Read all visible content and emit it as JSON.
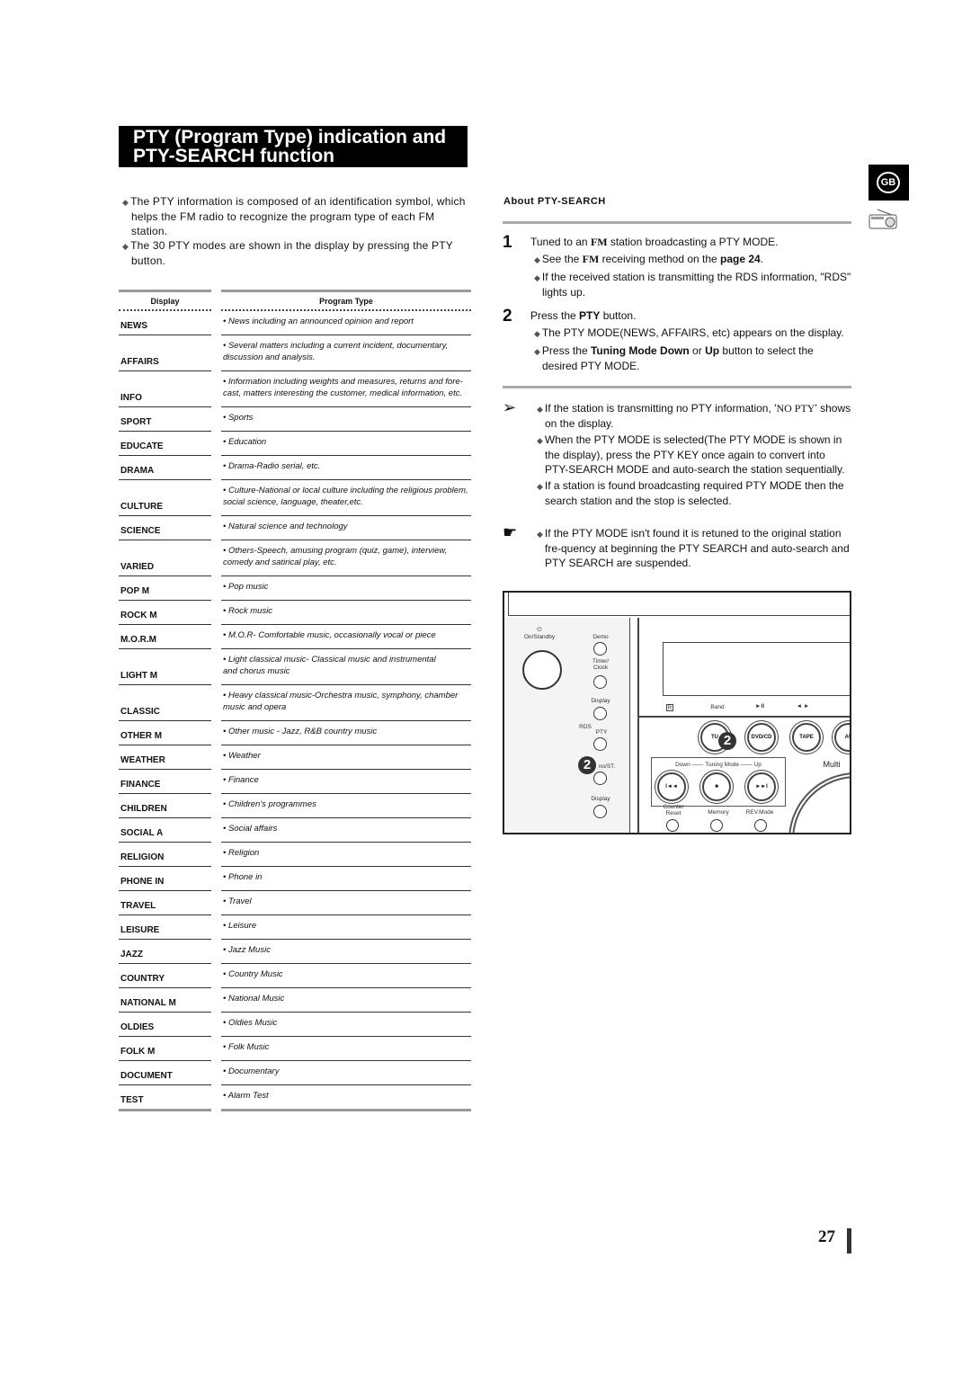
{
  "title": {
    "line1": "PTY (Program Type) indication and",
    "line2": "PTY-SEARCH function"
  },
  "intro": [
    "The PTY information is composed of an identification symbol, which helps the FM radio to recognize the program type of each FM station.",
    "The 30 PTY modes are shown in the display by pressing the PTY button."
  ],
  "table": {
    "headers": {
      "display": "Display",
      "program_type": "Program Type"
    },
    "rows": [
      {
        "display": "NEWS",
        "type": "• News including an announced opinion and report"
      },
      {
        "display": "AFFAIRS",
        "type": "• Several matters including a current incident, documentary,\n  discussion and analysis."
      },
      {
        "display": "INFO",
        "type": "•  Information including weights and measures, returns and fore-\n   cast, matters interesting the customer, medical information, etc."
      },
      {
        "display": "SPORT",
        "type": "• Sports"
      },
      {
        "display": "EDUCATE",
        "type": "• Education"
      },
      {
        "display": "DRAMA",
        "type": "• Drama-Radio serial, etc."
      },
      {
        "display": "CULTURE",
        "type": "• Culture-National or local culture including the religious problem,\n  social science, language, theater,etc."
      },
      {
        "display": "SCIENCE",
        "type": "• Natural science and technology"
      },
      {
        "display": "VARIED",
        "type": "• Others-Speech, amusing program (quiz, game), interview,\n  comedy and satirical play, etc."
      },
      {
        "display": "POP M",
        "type": "• Pop music"
      },
      {
        "display": "ROCK M",
        "type": "• Rock music"
      },
      {
        "display": "M.O.R.M",
        "type": "• M.O.R- Comfortable music, occasionally vocal or piece"
      },
      {
        "display": "LIGHT M",
        "type": "• Light classical music- Classical music and instrumental\n  and chorus music"
      },
      {
        "display": "CLASSIC",
        "type": "• Heavy classical  music-Orchestra music, symphony, chamber\n  music and opera"
      },
      {
        "display": "OTHER M",
        "type": "• Other music - Jazz, R&B country music"
      },
      {
        "display": "WEATHER",
        "type": "• Weather"
      },
      {
        "display": "FINANCE",
        "type": "• Finance"
      },
      {
        "display": "CHILDREN",
        "type": "• Children's programmes"
      },
      {
        "display": "SOCIAL  A",
        "type": "• Social affairs"
      },
      {
        "display": "RELIGION",
        "type": "• Religion"
      },
      {
        "display": "PHONE IN",
        "type": "• Phone in"
      },
      {
        "display": "TRAVEL",
        "type": "• Travel"
      },
      {
        "display": "LEISURE",
        "type": "• Leisure"
      },
      {
        "display": "JAZZ",
        "type": "• Jazz Music"
      },
      {
        "display": "COUNTRY",
        "type": "• Country Music"
      },
      {
        "display": "NATIONAL M",
        "type": "• National Music"
      },
      {
        "display": "OLDIES",
        "type": "• Oldies Music"
      },
      {
        "display": "FOLK M",
        "type": "• Folk Music"
      },
      {
        "display": "DOCUMENT",
        "type": "• Documentary"
      },
      {
        "display": "TEST",
        "type": "• Alarm Test"
      }
    ]
  },
  "about": {
    "heading": "About  PTY-SEARCH",
    "step1": {
      "num": "1",
      "pre": "Tuned to an ",
      "fm": "FM",
      "post": " station broadcasting a PTY MODE.",
      "sub1": {
        "pre": "See the ",
        "fm": "FM",
        "mid": " receiving method on the ",
        "bold": "page 24",
        "post": "."
      },
      "sub2": "If the received station is transmitting the RDS information, \"RDS\" lights up."
    },
    "step2": {
      "num": "2",
      "pre": "Press the ",
      "bold": "PTY",
      "post": " button.",
      "sub1": "The PTY MODE(NEWS, AFFAIRS, etc) appears on the display.",
      "sub2": {
        "pre": "Press the ",
        "b1": "Tuning Mode Down",
        "mid": " or ",
        "b2": "Up",
        "post": " button to select the desired PTY MODE."
      }
    },
    "notes": {
      "n1": {
        "pre": "If the station is transmitting no PTY information, '",
        "serif": "NO PTY",
        "post": "' shows on the display."
      },
      "n2": "When the PTY MODE is selected(The PTY MODE is shown in  the display), press the PTY KEY once again to convert into PTY-SEARCH MODE and auto-search the station sequentially.",
      "n3": "If a station is found broadcasting required PTY MODE then the search station and the stop is selected.",
      "n4": "If the PTY MODE isn't found it is retuned to the original station fre-quency at beginning the PTY SEARCH and auto-search and PTY SEARCH are suspended."
    }
  },
  "badge": "GB",
  "device": {
    "labels": {
      "on_standby": "On/Standby",
      "demo": "Demo",
      "timer_clock": "Timer/\nClock",
      "display1": "Display",
      "rds": "RDS",
      "pty": "PTY",
      "mono_st": "no/ST.",
      "display2": "Display",
      "band": "Band",
      "play_pause": "►II",
      "skip": "◄ ►",
      "r": "R",
      "tuner": "TU",
      "dvdcd": "DVD/CD",
      "tape": "TAPE",
      "aux": "AU",
      "down": "Down",
      "tuning_mode": "Tuning Mode",
      "up": "Up",
      "multi": "Multi",
      "counter_reset": "Counter\nReset",
      "memory": "Memory",
      "rev_mode": "REV.Mode",
      "prev": "I◄◄",
      "stop": "■",
      "next": "►►I"
    },
    "callout": "2"
  },
  "page_number": "27"
}
